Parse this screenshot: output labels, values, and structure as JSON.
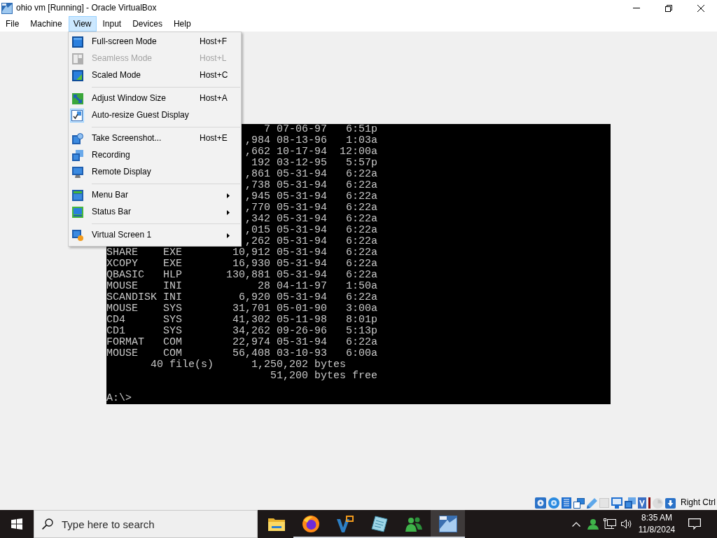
{
  "window": {
    "title": "ohio vm [Running] - Oracle VirtualBox"
  },
  "menu_bar": [
    {
      "label": "File",
      "selected": false
    },
    {
      "label": "Machine",
      "selected": false
    },
    {
      "label": "View",
      "selected": true
    },
    {
      "label": "Input",
      "selected": false
    },
    {
      "label": "Devices",
      "selected": false
    },
    {
      "label": "Help",
      "selected": false
    }
  ],
  "view_menu": [
    {
      "kind": "item",
      "label": "Full-screen Mode",
      "shortcut": "Host+F",
      "disabled": false,
      "checked": false
    },
    {
      "kind": "item",
      "label": "Seamless Mode",
      "shortcut": "Host+L",
      "disabled": true,
      "checked": false
    },
    {
      "kind": "item",
      "label": "Scaled Mode",
      "shortcut": "Host+C",
      "disabled": false,
      "checked": false
    },
    {
      "kind": "separator"
    },
    {
      "kind": "item",
      "label": "Adjust Window Size",
      "shortcut": "Host+A",
      "disabled": false,
      "checked": false
    },
    {
      "kind": "item",
      "label": "Auto-resize Guest Display",
      "disabled": false,
      "checked": true
    },
    {
      "kind": "separator"
    },
    {
      "kind": "item",
      "label": "Take Screenshot...",
      "shortcut": "Host+E",
      "disabled": false,
      "checked": false
    },
    {
      "kind": "item",
      "label": "Recording",
      "disabled": false,
      "checked": false
    },
    {
      "kind": "item",
      "label": "Remote Display",
      "disabled": false,
      "checked": false
    },
    {
      "kind": "separator"
    },
    {
      "kind": "submenu",
      "label": "Menu Bar",
      "disabled": false,
      "checked": false
    },
    {
      "kind": "submenu",
      "label": "Status Bar",
      "disabled": false,
      "checked": false
    },
    {
      "kind": "separator"
    },
    {
      "kind": "submenu",
      "label": "Virtual Screen 1",
      "disabled": false,
      "checked": false
    }
  ],
  "guest_screen": {
    "rows": [
      {
        "kind": "file",
        "size": "7",
        "date": "07-06-97",
        "time": "6:51p"
      },
      {
        "kind": "file",
        "size": ",984",
        "date": "08-13-96",
        "time": "1:03a"
      },
      {
        "kind": "file",
        "size": ",662",
        "date": "10-17-94",
        "time": "12:00a"
      },
      {
        "kind": "file",
        "size": "192",
        "date": "03-12-95",
        "time": "5:57p"
      },
      {
        "kind": "file",
        "size": ",861",
        "date": "05-31-94",
        "time": "6:22a"
      },
      {
        "kind": "file",
        "size": ",738",
        "date": "05-31-94",
        "time": "6:22a"
      },
      {
        "kind": "file",
        "size": ",945",
        "date": "05-31-94",
        "time": "6:22a"
      },
      {
        "kind": "file",
        "size": ",770",
        "date": "05-31-94",
        "time": "6:22a"
      },
      {
        "kind": "file",
        "size": ",342",
        "date": "05-31-94",
        "time": "6:22a"
      },
      {
        "kind": "file",
        "size": ",015",
        "date": "05-31-94",
        "time": "6:22a"
      },
      {
        "kind": "file",
        "size": ",262",
        "date": "05-31-94",
        "time": "6:22a"
      },
      {
        "kind": "file",
        "name": "SHARE",
        "ext": "EXE",
        "size": "10,912",
        "date": "05-31-94",
        "time": "6:22a"
      },
      {
        "kind": "file",
        "name": "XCOPY",
        "ext": "EXE",
        "size": "16,930",
        "date": "05-31-94",
        "time": "6:22a"
      },
      {
        "kind": "file",
        "name": "QBASIC",
        "ext": "HLP",
        "size": "130,881",
        "date": "05-31-94",
        "time": "6:22a"
      },
      {
        "kind": "file",
        "name": "MOUSE",
        "ext": "INI",
        "size": "28",
        "date": "04-11-97",
        "time": "1:50a"
      },
      {
        "kind": "file",
        "name": "SCANDISK",
        "ext": "INI",
        "size": "6,920",
        "date": "05-31-94",
        "time": "6:22a"
      },
      {
        "kind": "file",
        "name": "MOUSE",
        "ext": "SYS",
        "size": "31,701",
        "date": "05-01-90",
        "time": "3:00a"
      },
      {
        "kind": "file",
        "name": "CD4",
        "ext": "SYS",
        "size": "41,302",
        "date": "05-11-98",
        "time": "8:01p"
      },
      {
        "kind": "file",
        "name": "CD1",
        "ext": "SYS",
        "size": "34,262",
        "date": "09-26-96",
        "time": "5:13p"
      },
      {
        "kind": "file",
        "name": "FORMAT",
        "ext": "COM",
        "size": "22,974",
        "date": "05-31-94",
        "time": "6:22a"
      },
      {
        "kind": "file",
        "name": "MOUSE",
        "ext": "COM",
        "size": "56,408",
        "date": "03-10-93",
        "time": "6:00a"
      },
      {
        "kind": "total",
        "files": "40 file(s)",
        "bytes": "1,250,202 bytes"
      },
      {
        "kind": "free",
        "text": "51,200 bytes free"
      },
      {
        "kind": "blank"
      },
      {
        "kind": "prompt",
        "text": "A:\\>"
      }
    ]
  },
  "status_bar": {
    "host_key": "Right Ctrl"
  },
  "taskbar": {
    "search": {
      "placeholder": "Type here to search"
    },
    "apps": [
      {
        "kind": "folder",
        "running": false,
        "selected": false
      },
      {
        "kind": "browser",
        "running": true,
        "selected": false
      },
      {
        "kind": "editor",
        "running": true,
        "selected": false
      },
      {
        "kind": "notes",
        "running": true,
        "selected": false
      },
      {
        "kind": "chat",
        "running": true,
        "selected": false
      },
      {
        "kind": "vm",
        "running": true,
        "selected": true
      }
    ],
    "clock": {
      "time": "8:35 AM",
      "date": "11/8/2024"
    }
  }
}
